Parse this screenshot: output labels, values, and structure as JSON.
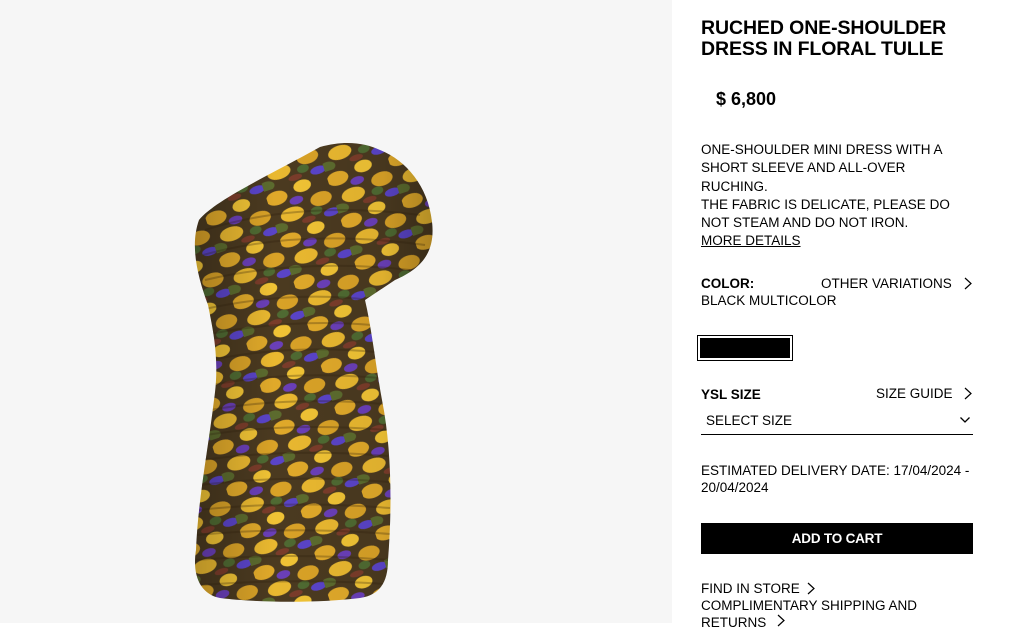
{
  "product": {
    "title": "RUCHED ONE-SHOULDER DRESS IN FLORAL TULLE",
    "price": "$ 6,800",
    "description": [
      "ONE-SHOULDER MINI DRESS WITH A SHORT SLEEVE AND ALL-OVER RUCHING.",
      "THE FABRIC IS DELICATE, PLEASE DO NOT STEAM AND DO NOT IRON."
    ],
    "more_details_label": "MORE DETAILS"
  },
  "color": {
    "label": "COLOR:",
    "value": "BLACK MULTICOLOR",
    "other_variations_label": "OTHER VARIATIONS",
    "swatch_color": "#000000"
  },
  "size": {
    "label": "YSL SIZE",
    "guide_label": "SIZE GUIDE",
    "select_value": "SELECT SIZE"
  },
  "delivery": {
    "text": "ESTIMATED DELIVERY DATE: 17/04/2024 - 20/04/2024"
  },
  "actions": {
    "add_to_cart_label": "ADD TO CART",
    "find_in_store_label": "FIND IN STORE",
    "shipping_label": "COMPLIMENTARY SHIPPING AND RETURNS"
  },
  "icons": {
    "chevron_right": "chevron-right-icon",
    "chevron_down": "chevron-down-icon"
  },
  "colors": {
    "gallery_background": "#f6f6f6",
    "button_background": "#000000",
    "button_text": "#ffffff",
    "print_yellow": "#e0a92a",
    "print_purple": "#6a3fb8",
    "print_green": "#5c6b2e",
    "print_brown": "#5a3a1e"
  }
}
